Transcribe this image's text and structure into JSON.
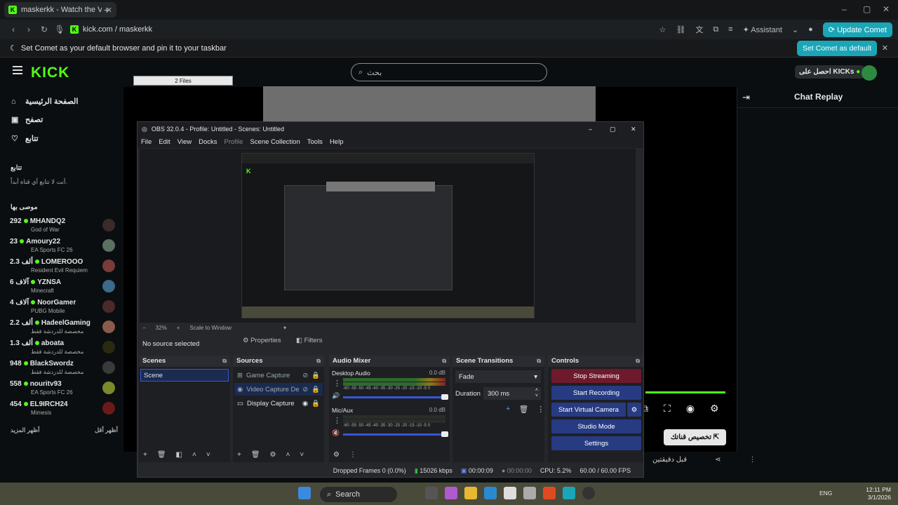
{
  "browser": {
    "tab_title": "maskerkk - Watch the VO",
    "url": "kick.com / maskerkk",
    "assistant_label": "Assistant",
    "update_label": "Update Comet",
    "banner_text": "Set Comet as your default browser and pin it to your taskbar",
    "set_default_label": "Set Comet as default"
  },
  "kick": {
    "logo": "KICK",
    "search_placeholder": "بحث",
    "get_kicks": "احصل على KICKs",
    "nav": [
      {
        "label": "الصفحة الرئيسية",
        "icon": "home-icon"
      },
      {
        "label": "تصفح",
        "icon": "browse-icon"
      },
      {
        "label": "تتابع",
        "icon": "heart-icon"
      }
    ],
    "following_title": "تتابع",
    "following_empty": "أنت لا تتابع أي قناة أبداً.",
    "recommended_title": "موصى بها",
    "recommended": [
      {
        "count": "292",
        "name": "MHANDQ2",
        "cat": "God of War",
        "color": "#3b2a2a"
      },
      {
        "count": "23",
        "name": "Amoury22",
        "cat": "EA Sports FC 26",
        "color": "#5a7060"
      },
      {
        "count": "2.3 ألف",
        "name": "LOMEROOO",
        "cat": "Resident Evil Requiem",
        "color": "#7a3b3b"
      },
      {
        "count": "6 آلاف",
        "name": "YZNSA",
        "cat": "Minecraft",
        "color": "#3b6a8a"
      },
      {
        "count": "4 آلاف",
        "name": "NoorGamer",
        "cat": "PUBG Mobile",
        "color": "#4a2a2a"
      },
      {
        "count": "2.2 ألف",
        "name": "HadeelGaming",
        "cat": "مخصصة للدردشة فقط",
        "color": "#8a5a4a"
      },
      {
        "count": "1.3 ألف",
        "name": "aboata",
        "cat": "مخصصة للدردشة فقط",
        "color": "#2a2a10"
      },
      {
        "count": "948",
        "name": "BlackSwordz",
        "cat": "مخصصة للدردشة فقط",
        "color": "#3a3a3a"
      },
      {
        "count": "558",
        "name": "nouritv93",
        "cat": "EA Sports FC 26",
        "color": "#7a8a2a"
      },
      {
        "count": "454",
        "name": "EL9IRCH24",
        "cat": "Mimesis",
        "color": "#6a1a1a"
      }
    ],
    "show_more": "أظهر المزيد",
    "show_less": "أظهر أقل",
    "chat_title": "Chat Replay",
    "clip_label": "تخصيص قناتك",
    "time_ago": "قبل دقيقتين",
    "whatsapp_label": "2 Files"
  },
  "obs": {
    "title": "OBS 32.0.4 - Profile: Untitled - Scenes: Untitled",
    "menu": [
      "File",
      "Edit",
      "View",
      "Docks",
      "Profile",
      "Scene Collection",
      "Tools",
      "Help"
    ],
    "zoom": "32%",
    "scale_label": "Scale to Window",
    "no_source": "No source selected",
    "properties": "Properties",
    "filters": "Filters",
    "scenes_title": "Scenes",
    "scene_item": "Scene",
    "sources_title": "Sources",
    "sources": [
      "Game Capture",
      "Video Capture Dev",
      "Display Capture"
    ],
    "mixer_title": "Audio Mixer",
    "mixer": [
      {
        "name": "Desktop Audio",
        "db": "0.0 dB"
      },
      {
        "name": "Mic/Aux",
        "db": "0.0 dB"
      }
    ],
    "meter_scale": "-60 -55 -50 -45 -40 -35 -30 -25 -20 -15 -10 -5 0",
    "transitions_title": "Scene Transitions",
    "transition": "Fade",
    "duration_label": "Duration",
    "duration": "300 ms",
    "controls_title": "Controls",
    "controls": [
      "Stop Streaming",
      "Start Recording",
      "Start Virtual Camera",
      "Studio Mode",
      "Settings"
    ],
    "status": {
      "dropped": "Dropped Frames 0 (0.0%)",
      "kbps": "15026 kbps",
      "stream_time": "00:00:09",
      "rec_time": "00:00:00",
      "cpu": "CPU: 5.2%",
      "fps": "60.00 / 60.00 FPS"
    }
  },
  "taskbar": {
    "search": "Search",
    "lang": "ENG",
    "time": "12:11 PM",
    "date": "3/1/2026"
  },
  "colors": {
    "kick_green": "#53fc18",
    "comet_teal": "#1aa6b7",
    "obs_blue": "#273b83",
    "obs_red": "#6e1a2c"
  }
}
